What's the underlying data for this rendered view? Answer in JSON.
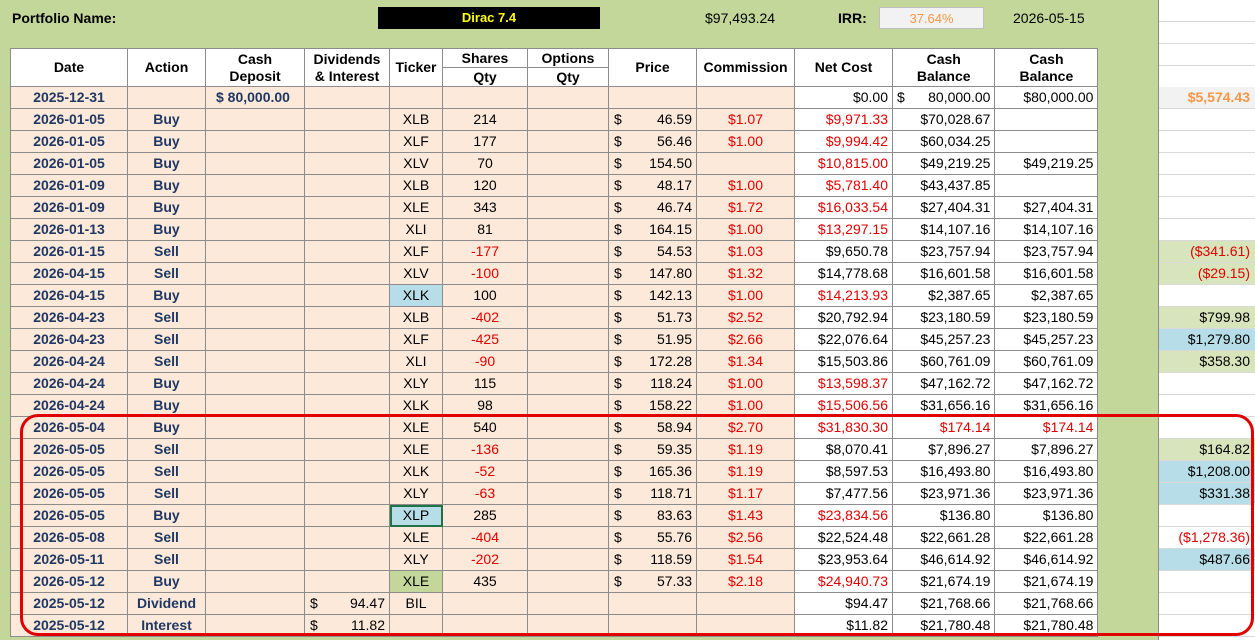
{
  "header": {
    "portfolio_label": "Portfolio Name:",
    "portfolio_name": "Dirac 7.4",
    "total_value": "$97,493.24",
    "irr_label": "IRR:",
    "irr_value": "37.64%",
    "date": "2026-05-15"
  },
  "columns": {
    "date": "Date",
    "action": "Action",
    "cash_deposit": "Cash\nDeposit",
    "dividends": "Dividends\n& Interest",
    "ticker": "Ticker",
    "shares": "Shares\nQty",
    "options": "Options\nQty",
    "price": "Price",
    "commission": "Commission",
    "net_cost": "Net Cost",
    "cash_balance1": "Cash\nBalance",
    "cash_balance2": "Cash\nBalance"
  },
  "rows": [
    {
      "date": "2025-12-31",
      "action": "",
      "deposit": "$ 80,000.00",
      "div": "",
      "ticker": "",
      "shares": "",
      "price": "",
      "comm": "",
      "net": "$0.00",
      "bal1": "$      80,000.00",
      "bal2": "$80,000.00",
      "right": "$5,574.43"
    },
    {
      "date": "2026-01-05",
      "action": "Buy",
      "deposit": "",
      "div": "",
      "ticker": "XLB",
      "shares": "214",
      "price": "46.59",
      "comm": "$1.07",
      "net": "$9,971.33",
      "bal1": "$70,028.67",
      "bal2": "",
      "right": ""
    },
    {
      "date": "2026-01-05",
      "action": "Buy",
      "deposit": "",
      "div": "",
      "ticker": "XLF",
      "shares": "177",
      "price": "56.46",
      "comm": "$1.00",
      "net": "$9,994.42",
      "bal1": "$60,034.25",
      "bal2": "",
      "right": ""
    },
    {
      "date": "2026-01-05",
      "action": "Buy",
      "deposit": "",
      "div": "",
      "ticker": "XLV",
      "shares": "70",
      "price": "154.50",
      "comm": "",
      "net": "$10,815.00",
      "bal1": "$49,219.25",
      "bal2": "$49,219.25",
      "right": ""
    },
    {
      "date": "2026-01-09",
      "action": "Buy",
      "deposit": "",
      "div": "",
      "ticker": "XLB",
      "shares": "120",
      "price": "48.17",
      "comm": "$1.00",
      "net": "$5,781.40",
      "bal1": "$43,437.85",
      "bal2": "",
      "right": ""
    },
    {
      "date": "2026-01-09",
      "action": "Buy",
      "deposit": "",
      "div": "",
      "ticker": "XLE",
      "shares": "343",
      "price": "46.74",
      "comm": "$1.72",
      "net": "$16,033.54",
      "bal1": "$27,404.31",
      "bal2": "$27,404.31",
      "right": ""
    },
    {
      "date": "2026-01-13",
      "action": "Buy",
      "deposit": "",
      "div": "",
      "ticker": "XLI",
      "shares": "81",
      "price": "164.15",
      "comm": "$1.00",
      "net": "$13,297.15",
      "bal1": "$14,107.16",
      "bal2": "$14,107.16",
      "right": ""
    },
    {
      "date": "2026-01-15",
      "action": "Sell",
      "deposit": "",
      "div": "",
      "ticker": "XLF",
      "shares": "-177",
      "price": "54.53",
      "comm": "$1.03",
      "net": "$9,650.78",
      "bal1": "$23,757.94",
      "bal2": "$23,757.94",
      "right": "($341.61)"
    },
    {
      "date": "2026-04-15",
      "action": "Sell",
      "deposit": "",
      "div": "",
      "ticker": "XLV",
      "shares": "-100",
      "price": "147.80",
      "comm": "$1.32",
      "net": "$14,778.68",
      "bal1": "$16,601.58",
      "bal2": "$16,601.58",
      "right": "($29.15)"
    },
    {
      "date": "2026-04-15",
      "action": "Buy",
      "deposit": "",
      "div": "",
      "ticker": "XLK",
      "shares": "100",
      "price": "142.13",
      "comm": "$1.00",
      "net": "$14,213.93",
      "bal1": "$2,387.65",
      "bal2": "$2,387.65",
      "right": ""
    },
    {
      "date": "2026-04-23",
      "action": "Sell",
      "deposit": "",
      "div": "",
      "ticker": "XLB",
      "shares": "-402",
      "price": "51.73",
      "comm": "$2.52",
      "net": "$20,792.94",
      "bal1": "$23,180.59",
      "bal2": "$23,180.59",
      "right": "$799.98"
    },
    {
      "date": "2026-04-23",
      "action": "Sell",
      "deposit": "",
      "div": "",
      "ticker": "XLF",
      "shares": "-425",
      "price": "51.95",
      "comm": "$2.66",
      "net": "$22,076.64",
      "bal1": "$45,257.23",
      "bal2": "$45,257.23",
      "right": "$1,279.80"
    },
    {
      "date": "2026-04-24",
      "action": "Sell",
      "deposit": "",
      "div": "",
      "ticker": "XLI",
      "shares": "-90",
      "price": "172.28",
      "comm": "$1.34",
      "net": "$15,503.86",
      "bal1": "$60,761.09",
      "bal2": "$60,761.09",
      "right": "$358.30"
    },
    {
      "date": "2026-04-24",
      "action": "Buy",
      "deposit": "",
      "div": "",
      "ticker": "XLY",
      "shares": "115",
      "price": "118.24",
      "comm": "$1.00",
      "net": "$13,598.37",
      "bal1": "$47,162.72",
      "bal2": "$47,162.72",
      "right": ""
    },
    {
      "date": "2026-04-24",
      "action": "Buy",
      "deposit": "",
      "div": "",
      "ticker": "XLK",
      "shares": "98",
      "price": "158.22",
      "comm": "$1.00",
      "net": "$15,506.56",
      "bal1": "$31,656.16",
      "bal2": "$31,656.16",
      "right": ""
    },
    {
      "date": "2026-05-04",
      "action": "Buy",
      "deposit": "",
      "div": "",
      "ticker": "XLE",
      "shares": "540",
      "price": "58.94",
      "comm": "$2.70",
      "net": "$31,830.30",
      "bal1": "$174.14",
      "bal2": "$174.14",
      "right": ""
    },
    {
      "date": "2026-05-05",
      "action": "Sell",
      "deposit": "",
      "div": "",
      "ticker": "XLE",
      "shares": "-136",
      "price": "59.35",
      "comm": "$1.19",
      "net": "$8,070.41",
      "bal1": "$7,896.27",
      "bal2": "$7,896.27",
      "right": "$164.82"
    },
    {
      "date": "2026-05-05",
      "action": "Sell",
      "deposit": "",
      "div": "",
      "ticker": "XLK",
      "shares": "-52",
      "price": "165.36",
      "comm": "$1.19",
      "net": "$8,597.53",
      "bal1": "$16,493.80",
      "bal2": "$16,493.80",
      "right": "$1,208.00"
    },
    {
      "date": "2026-05-05",
      "action": "Sell",
      "deposit": "",
      "div": "",
      "ticker": "XLY",
      "shares": "-63",
      "price": "118.71",
      "comm": "$1.17",
      "net": "$7,477.56",
      "bal1": "$23,971.36",
      "bal2": "$23,971.36",
      "right": "$331.38"
    },
    {
      "date": "2026-05-05",
      "action": "Buy",
      "deposit": "",
      "div": "",
      "ticker": "XLP",
      "shares": "285",
      "price": "83.63",
      "comm": "$1.43",
      "net": "$23,834.56",
      "bal1": "$136.80",
      "bal2": "$136.80",
      "right": ""
    },
    {
      "date": "2026-05-08",
      "action": "Sell",
      "deposit": "",
      "div": "",
      "ticker": "XLE",
      "shares": "-404",
      "price": "55.76",
      "comm": "$2.56",
      "net": "$22,524.48",
      "bal1": "$22,661.28",
      "bal2": "$22,661.28",
      "right": "($1,278.36)"
    },
    {
      "date": "2026-05-11",
      "action": "Sell",
      "deposit": "",
      "div": "",
      "ticker": "XLY",
      "shares": "-202",
      "price": "118.59",
      "comm": "$1.54",
      "net": "$23,953.64",
      "bal1": "$46,614.92",
      "bal2": "$46,614.92",
      "right": "$487.66"
    },
    {
      "date": "2026-05-12",
      "action": "Buy",
      "deposit": "",
      "div": "",
      "ticker": "XLE",
      "shares": "435",
      "price": "57.33",
      "comm": "$2.18",
      "net": "$24,940.73",
      "bal1": "$21,674.19",
      "bal2": "$21,674.19",
      "right": ""
    },
    {
      "date": "2025-05-12",
      "action": "Dividend",
      "deposit": "",
      "div": "94.47",
      "ticker": "BIL",
      "shares": "",
      "price": "",
      "comm": "",
      "net": "$94.47",
      "bal1": "$21,768.66",
      "bal2": "$21,768.66",
      "right": ""
    },
    {
      "date": "2025-05-12",
      "action": "Interest",
      "deposit": "",
      "div": "11.82",
      "ticker": "",
      "shares": "",
      "price": "",
      "comm": "",
      "net": "$11.82",
      "bal1": "$21,780.48",
      "bal2": "$21,780.48",
      "right": ""
    }
  ],
  "colors": {
    "sheet_bg": "#c4d79b",
    "row_bg": "#fde9d9",
    "negative": "#e00000",
    "irr": "#f79646",
    "accent_header": "#ffff00"
  }
}
